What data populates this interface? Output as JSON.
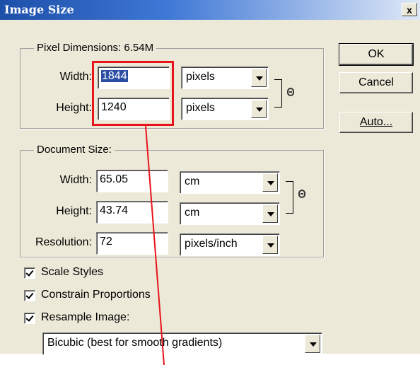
{
  "window": {
    "title": "Image Size",
    "close_glyph": "x"
  },
  "pixel_dimensions": {
    "legend": "Pixel Dimensions:  6.54M",
    "width": {
      "label": "Width:",
      "value": "1844",
      "unit": "pixels"
    },
    "height": {
      "label": "Height:",
      "value": "1240",
      "unit": "pixels"
    }
  },
  "document_size": {
    "legend": "Document Size:",
    "width": {
      "label": "Width:",
      "value": "65.05",
      "unit": "cm"
    },
    "height": {
      "label": "Height:",
      "value": "43.74",
      "unit": "cm"
    },
    "resolution": {
      "label": "Resolution:",
      "value": "72",
      "unit": "pixels/inch"
    }
  },
  "buttons": {
    "ok": "OK",
    "cancel": "Cancel",
    "auto": "Auto..."
  },
  "options": {
    "scale_styles": {
      "label": "Scale Styles",
      "checked": true
    },
    "constrain_proportions": {
      "label": "Constrain Proportions",
      "checked": true
    },
    "resample_image": {
      "label": "Resample Image:",
      "checked": true
    },
    "resample_method": "Bicubic (best for smooth gradients)"
  },
  "annotation": {
    "color": "#e8141c"
  },
  "icons": {
    "link_chain": "chain-link-icon",
    "dropdown_arrow": "chevron-down-icon"
  }
}
